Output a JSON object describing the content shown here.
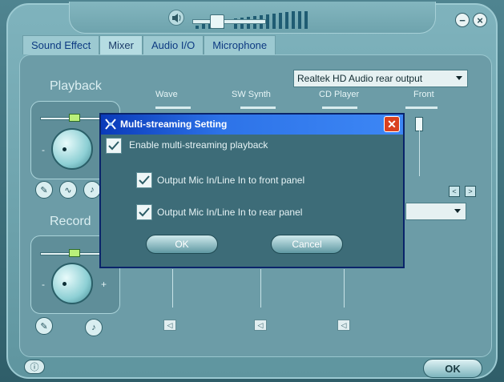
{
  "tabs": [
    "Sound Effect",
    "Mixer",
    "Audio I/O",
    "Microphone"
  ],
  "playback": {
    "title": "Playback",
    "output_select": "Realtek HD Audio rear output",
    "columns": [
      "Wave",
      "SW Synth",
      "CD Player",
      "Front"
    ]
  },
  "record": {
    "title": "Record"
  },
  "knob_minus": "-",
  "knob_plus": "+",
  "main_ok": "OK",
  "dialog": {
    "title": "Multi-streaming Setting",
    "enable_label": "Enable multi-streaming playback",
    "front_label": "Output Mic In/Line In to front panel",
    "rear_label": "Output Mic In/Line In to rear panel",
    "ok_label": "OK",
    "cancel_label": "Cancel"
  },
  "colors": {
    "titlebar": "#0a3ab9",
    "accent": "#6c9ca7",
    "tab_text": "#0d3a82"
  },
  "icons": [
    "speaker-icon",
    "minimize-icon",
    "close-icon",
    "wrench-icon",
    "wave-icon",
    "mute-icon",
    "info-icon",
    "checkmark-icon",
    "app-icon"
  ]
}
